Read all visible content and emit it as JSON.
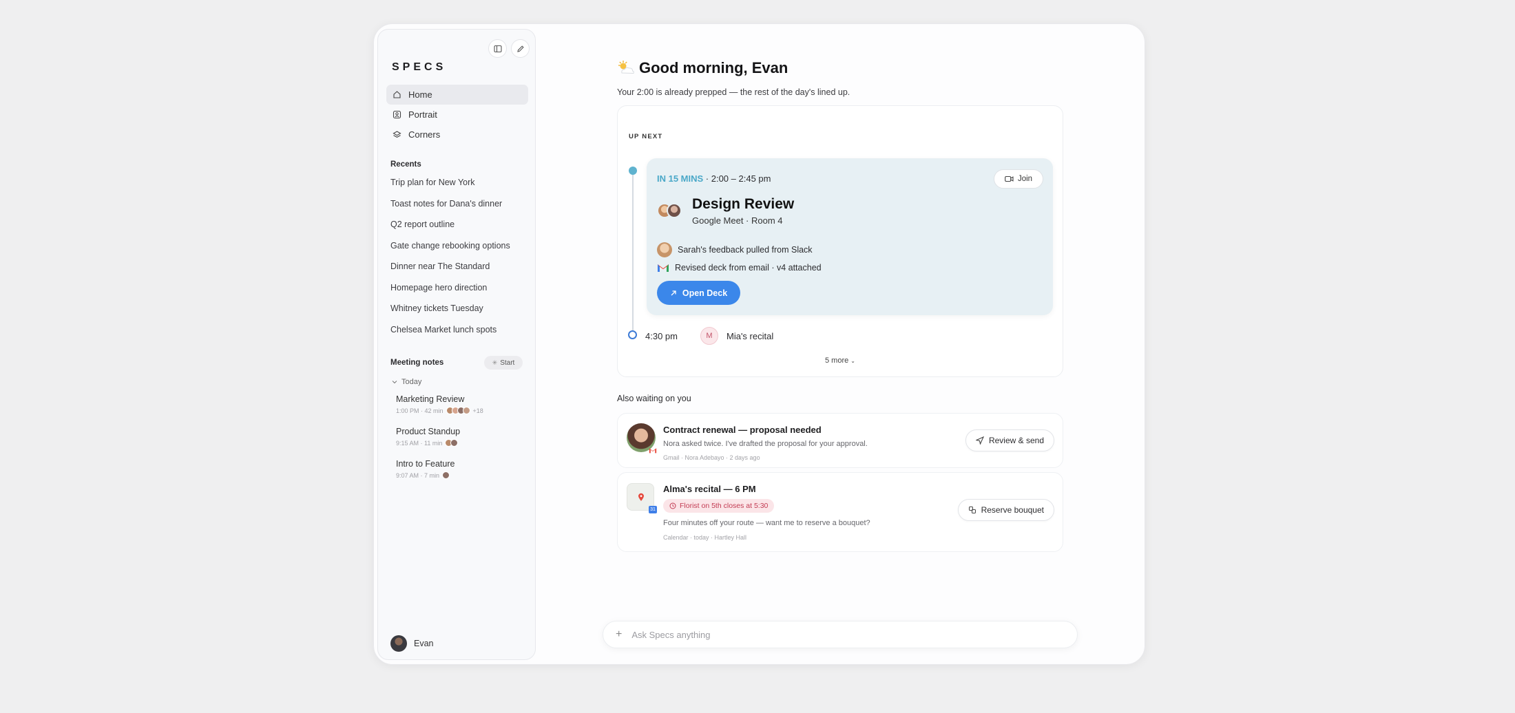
{
  "app": {
    "logo": "SPECS"
  },
  "sidebar": {
    "nav": [
      {
        "label": "Home",
        "icon": "home-icon",
        "active": true
      },
      {
        "label": "Portrait",
        "icon": "portrait-icon",
        "active": false
      },
      {
        "label": "Corners",
        "icon": "layers-icon",
        "active": false
      }
    ],
    "recents_title": "Recents",
    "recents": [
      "Trip plan for New York",
      "Toast notes for Dana's dinner",
      "Q2 report outline",
      "Gate change rebooking options",
      "Dinner near The Standard",
      "Homepage hero direction",
      "Whitney tickets Tuesday",
      "Chelsea Market lunch spots"
    ],
    "meeting_notes_title": "Meeting notes",
    "start_label": "Start",
    "today_label": "Today",
    "meetings": [
      {
        "title": "Marketing Review",
        "meta": "1:00 PM · 42 min",
        "extra": "+18"
      },
      {
        "title": "Product Standup",
        "meta": "9:15 AM · 11 min",
        "extra": ""
      },
      {
        "title": "Intro to Feature",
        "meta": "9:07 AM · 7 min",
        "extra": ""
      }
    ],
    "user_name": "Evan"
  },
  "main": {
    "greeting": "Good morning, Evan",
    "subtitle": "Your 2:00 is already prepped — the rest of the day's lined up.",
    "up_next": {
      "label": "UP NEXT",
      "soon": "IN 15 MINS",
      "time": " · 2:00 – 2:45 pm",
      "join_label": "Join",
      "title": "Design Review",
      "location": "Google Meet · Room 4",
      "item1": "Sarah's feedback pulled from Slack",
      "item2": "Revised deck from email · v4 attached",
      "open_label": "Open Deck",
      "later_time": "4:30 pm",
      "later_badge": "M",
      "later_title": "Mia's recital",
      "more_label": "5 more"
    },
    "also_title": "Also waiting on you",
    "card1": {
      "title": "Contract renewal — proposal needed",
      "body": "Nora asked twice. I've drafted the proposal for your approval.",
      "meta": "Gmail · Nora Adebayo · 2 days ago",
      "button": "Review & send"
    },
    "card2": {
      "title": "Alma's recital — 6 PM",
      "pill": "Florist on 5th closes at 5:30",
      "body": "Four minutes off your route — want me to reserve a bouquet?",
      "meta": "Calendar · today · Hartley Hall",
      "button": "Reserve bouquet",
      "cal_badge": "31"
    },
    "ask_placeholder": "Ask Specs anything"
  },
  "colors": {
    "accent": "#3b87ea",
    "soon": "#4aa8c8",
    "event_bg": "#e7f0f4",
    "alert": "#c23a52"
  }
}
